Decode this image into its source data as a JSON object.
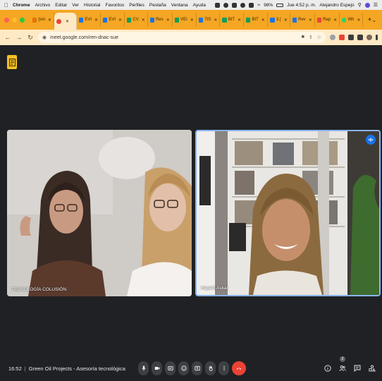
{
  "menubar": {
    "items": [
      "Chrome",
      "Archivo",
      "Editar",
      "Ver",
      "Historial",
      "Favoritos",
      "Perfiles",
      "Pestaña",
      "Ventana",
      "Ayuda"
    ],
    "battery": "98%",
    "clock": "Jue 4:52 p. m.",
    "user": "Alejandro Espejo"
  },
  "tabs": [
    {
      "label": "(sin",
      "color": "#e37400"
    },
    {
      "label": "",
      "color": "#ea4335"
    },
    {
      "label": "EVI",
      "color": "#1a73e8"
    },
    {
      "label": "EVI",
      "color": "#1a73e8"
    },
    {
      "label": "CV",
      "color": "#0f9d58"
    },
    {
      "label": "Res",
      "color": "#1a73e8"
    },
    {
      "label": "VEI",
      "color": "#0f9d58"
    },
    {
      "label": "TIS",
      "color": "#1a73e8"
    },
    {
      "label": "BIT",
      "color": "#0f9d58"
    },
    {
      "label": "BIT",
      "color": "#0f9d58"
    },
    {
      "label": "3.(",
      "color": "#1a73e8"
    },
    {
      "label": "Rev",
      "color": "#1a73e8"
    },
    {
      "label": "Rap",
      "color": "#ea4335"
    },
    {
      "label": "Wh",
      "color": "#25d366"
    }
  ],
  "address": {
    "url": "meet.google.com/ren-dnac-sue"
  },
  "participants": [
    {
      "name": "TECNOLOGÍA COLUSIÓN"
    },
    {
      "name": "Hayeth Askar"
    }
  ],
  "meeting": {
    "time": "16:52",
    "title": "Green Oil Projects - Asesoría tecnológica",
    "participant_count": "2"
  },
  "colors": {
    "tab_strip": "#f5a623",
    "end_call": "#ea4335",
    "active_speaker": "#8ab4f8",
    "notes_button": "#f6c026"
  }
}
